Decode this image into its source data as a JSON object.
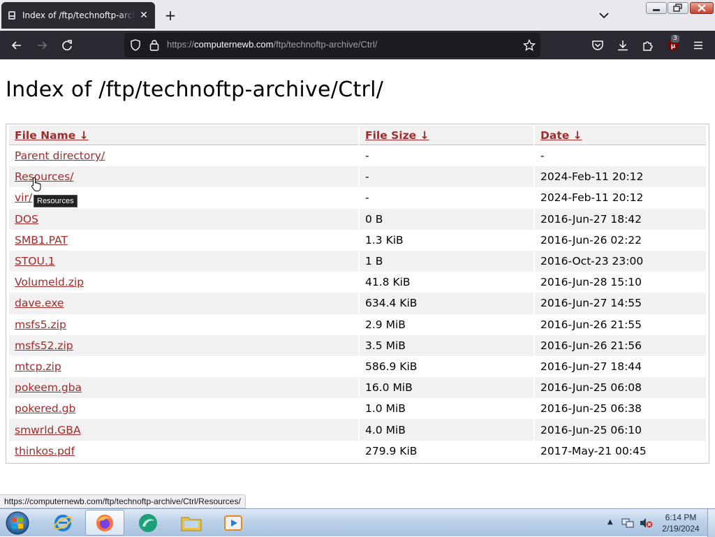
{
  "browser": {
    "tab_title": "Index of /ftp/technoftp-archive/Ctrl/",
    "url_prefix": "https://",
    "url_host": "computernewb.com",
    "url_path": "/ftp/technoftp-archive/Ctrl/",
    "ublock_count": "3"
  },
  "page": {
    "title": "Index of /ftp/technoftp-archive/Ctrl/",
    "columns": {
      "name": "File Name",
      "size": "File Size",
      "date": "Date",
      "sort_arrow": "↓"
    },
    "rows": [
      {
        "name": "Parent directory/",
        "size": "-",
        "date": "-"
      },
      {
        "name": "Resources/",
        "size": "-",
        "date": "2024-Feb-11 20:12"
      },
      {
        "name": "vir/",
        "size": "-",
        "date": "2024-Feb-11 20:12"
      },
      {
        "name": "DOS",
        "size": "0 B",
        "date": "2016-Jun-27 18:42"
      },
      {
        "name": "SMB1.PAT",
        "size": "1.3 KiB",
        "date": "2016-Jun-26 02:22"
      },
      {
        "name": "STOU.1",
        "size": "1 B",
        "date": "2016-Oct-23 23:00"
      },
      {
        "name": "Volumeld.zip",
        "size": "41.8 KiB",
        "date": "2016-Jun-28 15:10"
      },
      {
        "name": "dave.exe",
        "size": "634.4 KiB",
        "date": "2016-Jun-27 14:55"
      },
      {
        "name": "msfs5.zip",
        "size": "2.9 MiB",
        "date": "2016-Jun-26 21:55"
      },
      {
        "name": "msfs52.zip",
        "size": "3.5 MiB",
        "date": "2016-Jun-26 21:56"
      },
      {
        "name": "mtcp.zip",
        "size": "586.9 KiB",
        "date": "2016-Jun-27 18:44"
      },
      {
        "name": "pokeem.gba",
        "size": "16.0 MiB",
        "date": "2016-Jun-25 06:08"
      },
      {
        "name": "pokered.gb",
        "size": "1.0 MiB",
        "date": "2016-Jun-25 06:38"
      },
      {
        "name": "smwrld.GBA",
        "size": "4.0 MiB",
        "date": "2016-Jun-25 06:10"
      },
      {
        "name": "thinkos.pdf",
        "size": "279.9 KiB",
        "date": "2017-May-21 00:45"
      }
    ],
    "tooltip": "Resources"
  },
  "status_url": "https://computernewb.com/ftp/technoftp-archive/Ctrl/Resources/",
  "taskbar": {
    "time": "6:14 PM",
    "date": "2/19/2024"
  },
  "colors": {
    "link": "#a52a2a",
    "toolbar": "#2b2a33",
    "urlbar": "#1c1b22"
  },
  "icons": [
    "tab-favicon-icon",
    "close-icon",
    "plus-icon",
    "chevron-down-icon",
    "back-icon",
    "forward-icon",
    "reload-icon",
    "shield-icon",
    "lock-icon",
    "star-icon",
    "pocket-icon",
    "download-icon",
    "puzzle-icon",
    "ublock-icon",
    "hamburger-menu-icon",
    "windows-start-icon",
    "ie-icon",
    "firefox-icon",
    "explorer-folder-icon",
    "media-player-icon",
    "network-icon",
    "volume-muted-icon"
  ]
}
